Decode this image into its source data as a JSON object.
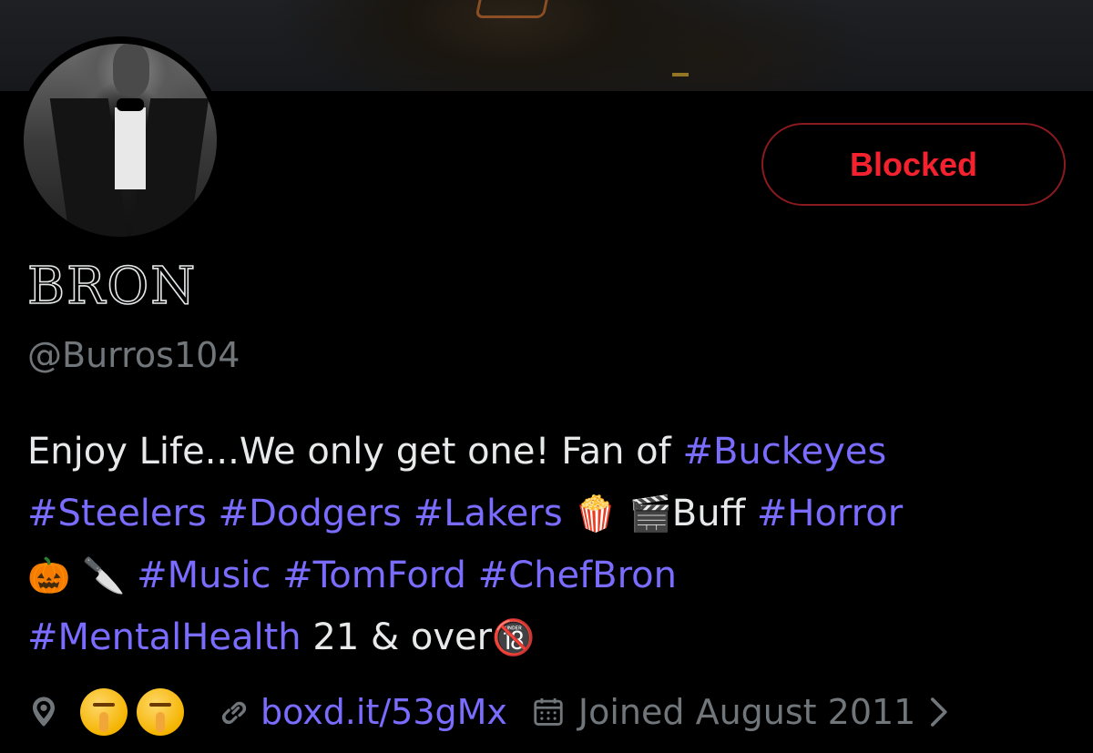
{
  "profile": {
    "action_button_label": "Blocked",
    "display_name": "BRON",
    "handle": "@Burros104"
  },
  "bio": {
    "line1_text": "Enjoy Life...We only get one! Fan of ",
    "line1_tag": "#Buckeyes",
    "line2_tags": [
      "#Steelers",
      "#Dodgers",
      "#Lakers"
    ],
    "line2_emoji_popcorn": "🍿",
    "line2_emoji_clapper": "🎬",
    "line2_text": "Buff ",
    "line2_tag_end": "#Horror",
    "line3_emoji_pumpkin": "🎃",
    "line3_emoji_knife": "🔪",
    "line3_tags": [
      "#Music",
      "#TomFord",
      "#ChefBron"
    ],
    "line4_tag": "#MentalHealth",
    "line4_text": " 21 & over",
    "line4_emoji": "🔞"
  },
  "meta": {
    "location_icon": "location-pin-icon",
    "location_value": "🤫 🤫",
    "link_icon": "link-icon",
    "link_text": "boxd.it/53gMx",
    "calendar_icon": "calendar-icon",
    "joined_text": "Joined August 2011",
    "chevron_icon": "chevron-right-icon"
  },
  "colors": {
    "background": "#000000",
    "blocked_red": "#f4212e",
    "blocked_border": "#8b1a1f",
    "hashtag": "#7a6cff",
    "secondary_text": "#71767b",
    "primary_text": "#e7e9ea"
  }
}
